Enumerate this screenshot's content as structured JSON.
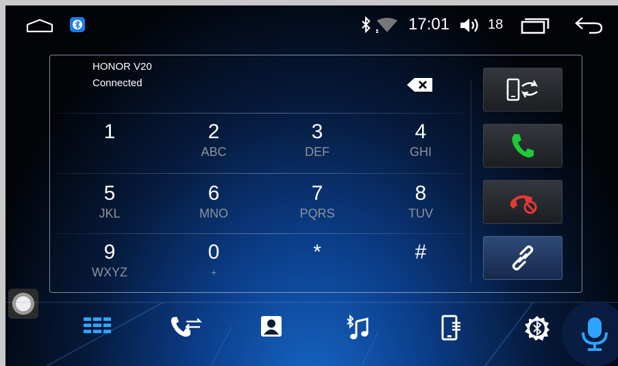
{
  "status_bar": {
    "time": "17:01",
    "volume_level": "18",
    "icons": [
      "home-icon",
      "bluetooth-app-icon",
      "bluetooth-icon",
      "wifi-icon",
      "volume-icon",
      "recent-apps-icon",
      "back-icon"
    ]
  },
  "device": {
    "name": "HONOR V20",
    "status": "Connected"
  },
  "keypad": [
    {
      "num": "1",
      "sub": ""
    },
    {
      "num": "2",
      "sub": "ABC"
    },
    {
      "num": "3",
      "sub": "DEF"
    },
    {
      "num": "4",
      "sub": "GHI"
    },
    {
      "num": "5",
      "sub": "JKL"
    },
    {
      "num": "6",
      "sub": "MNO"
    },
    {
      "num": "7",
      "sub": "PQRS"
    },
    {
      "num": "8",
      "sub": "TUV"
    },
    {
      "num": "9",
      "sub": "WXYZ"
    },
    {
      "num": "0",
      "sub": "+"
    },
    {
      "num": "*",
      "sub": ""
    },
    {
      "num": "#",
      "sub": ""
    }
  ],
  "side_buttons": [
    "switch-audio-to-phone",
    "call",
    "hang-up",
    "link-device"
  ],
  "bottom_nav": [
    "dialpad",
    "recent-calls",
    "contacts",
    "bluetooth-music",
    "phone-device",
    "bluetooth-settings"
  ],
  "colors": {
    "call_green": "#1ec93a",
    "hangup_red": "#e53935",
    "active_tab": "#2aa7ff",
    "mic_blue": "#2ea3ff"
  }
}
